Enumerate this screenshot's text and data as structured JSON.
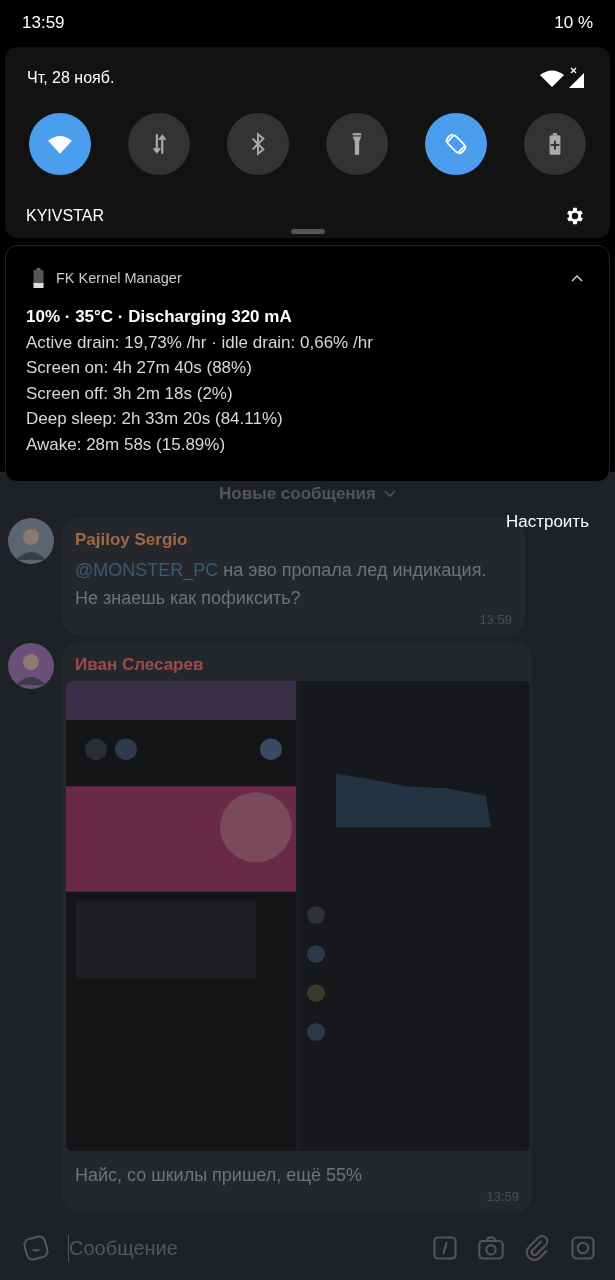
{
  "status_bar": {
    "time": "13:59",
    "battery": "10 %"
  },
  "quick_settings": {
    "date": "Чт, 28 нояб.",
    "tiles": [
      {
        "kind": "wifi",
        "on": true
      },
      {
        "kind": "data",
        "on": false
      },
      {
        "kind": "bluetooth",
        "on": false
      },
      {
        "kind": "flashlight",
        "on": false
      },
      {
        "kind": "rotate",
        "on": true
      },
      {
        "kind": "battery",
        "on": false
      }
    ],
    "carrier": "KYIVSTAR"
  },
  "notification": {
    "app": "FK Kernel Manager",
    "title": "10% · 35°C · Discharging 320 mA",
    "lines": [
      "Active drain: 19,73% /hr · idle drain: 0,66% /hr",
      "Screen on: 4h 27m 40s  (88%)",
      "Screen off: 3h 2m 18s  (2%)",
      "Deep sleep: 2h 33m 20s  (84.11%)",
      "Awake: 28m 58s  (15.89%)"
    ]
  },
  "chat": {
    "new_messages": "Новые сообщения",
    "settings_button": "Настроить",
    "messages": [
      {
        "author": "Pajiloy Sergio",
        "color": "#a0674a",
        "mention": "@MONSTER_PC",
        "text": "на эво пропала лед индикация. Не знаешь как пофиксить?",
        "time": "13:59"
      },
      {
        "author": "Иван Слесарев",
        "color": "#a04a4a",
        "text": "Найс, со шкилы пришел, ещё 55%",
        "time": "13:59"
      }
    ],
    "input": {
      "placeholder": "Сообщение"
    }
  }
}
